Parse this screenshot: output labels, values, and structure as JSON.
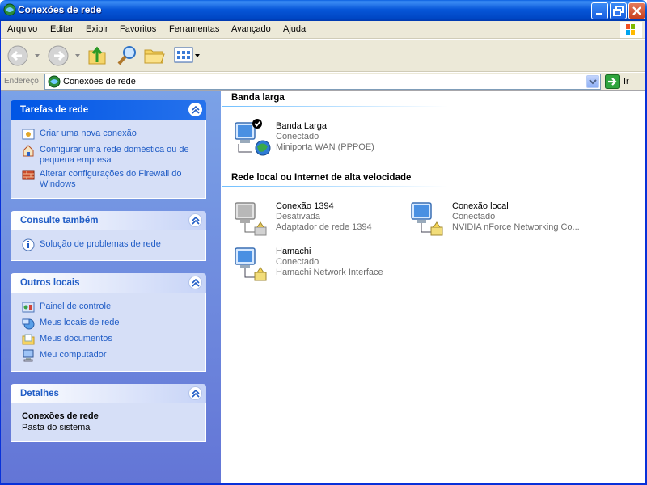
{
  "window": {
    "title": "Conexões de rede",
    "icon": "network-connections-icon"
  },
  "menu": [
    "Arquivo",
    "Editar",
    "Exibir",
    "Favoritos",
    "Ferramentas",
    "Avançado",
    "Ajuda"
  ],
  "address": {
    "label": "Endereço",
    "value": "Conexões de rede",
    "go_label": "Ir"
  },
  "left": {
    "tasks": {
      "title": "Tarefas de rede",
      "links": [
        "Criar uma nova conexão",
        "Configurar uma rede doméstica ou de pequena empresa",
        "Alterar configurações do Firewall do Windows"
      ]
    },
    "see_also": {
      "title": "Consulte também",
      "links": [
        "Solução de problemas de rede"
      ]
    },
    "other": {
      "title": "Outros locais",
      "links": [
        "Painel de controle",
        "Meus locais de rede",
        "Meus documentos",
        "Meu computador"
      ]
    },
    "details": {
      "title": "Detalhes",
      "name": "Conexões de rede",
      "type": "Pasta do sistema"
    }
  },
  "sections": {
    "broadband": {
      "title": "Banda larga",
      "items": [
        {
          "name": "Banda Larga",
          "status": "Conectado",
          "device": "Miniporta WAN (PPPOE)"
        }
      ]
    },
    "lan": {
      "title": "Rede local ou Internet de alta velocidade",
      "items": [
        {
          "name": "Conexão 1394",
          "status": "Desativada",
          "device": "Adaptador de rede 1394"
        },
        {
          "name": "Conexão local",
          "status": "Conectado",
          "device": "NVIDIA nForce Networking Co..."
        },
        {
          "name": "Hamachi",
          "status": "Conectado",
          "device": "Hamachi Network Interface"
        }
      ]
    }
  },
  "colors": {
    "titlebar": "#0054e3",
    "link": "#215dc6",
    "pane_top": "#7ba2e7",
    "pane_bottom": "#6375d6"
  }
}
